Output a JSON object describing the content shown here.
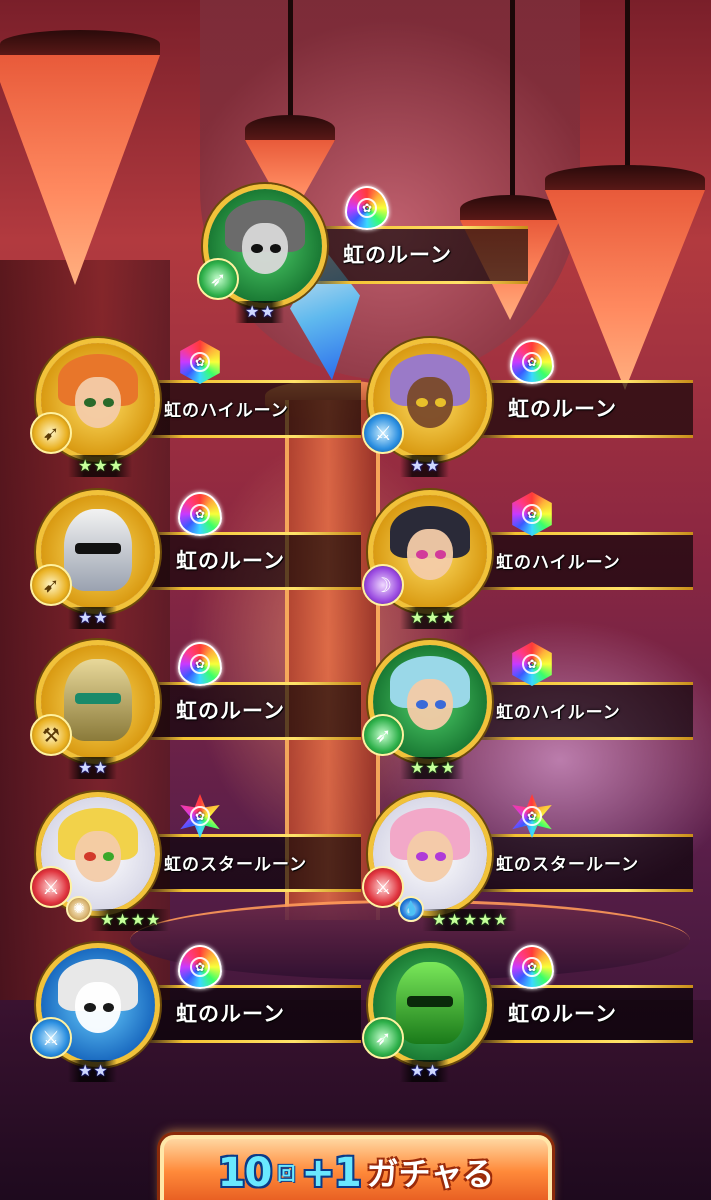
{
  "results": [
    {
      "id": "wolf-cat",
      "rune_name": "虹のルーン",
      "rune_type": "drop",
      "stars": "★★",
      "class_icon": "spear",
      "portrait_ring": "green",
      "theme": "grey"
    },
    {
      "id": "cat-girl",
      "rune_name": "虹のハイルーン",
      "rune_type": "hex",
      "stars": "★★★",
      "class_icon": "bow",
      "portrait_ring": "yellow",
      "theme": "orange"
    },
    {
      "id": "dark-elf",
      "rune_name": "虹のルーン",
      "rune_type": "drop",
      "stars": "★★",
      "class_icon": "sword",
      "portrait_ring": "yellow",
      "theme": "purple"
    },
    {
      "id": "knight-silver",
      "rune_name": "虹のルーン",
      "rune_type": "drop",
      "stars": "★★",
      "class_icon": "bow",
      "portrait_ring": "yellow",
      "theme": "silver"
    },
    {
      "id": "hood-girl",
      "rune_name": "虹のハイルーン",
      "rune_type": "hex",
      "stars": "★★★",
      "class_icon": "magic",
      "portrait_ring": "yellow",
      "theme": "green"
    },
    {
      "id": "knight-gold",
      "rune_name": "虹のルーン",
      "rune_type": "drop",
      "stars": "★★",
      "class_icon": "hammer",
      "portrait_ring": "yellow",
      "theme": "gold"
    },
    {
      "id": "blue-hair",
      "rune_name": "虹のハイルーン",
      "rune_type": "hex",
      "stars": "★★★",
      "class_icon": "spear",
      "portrait_ring": "green",
      "theme": "blue"
    },
    {
      "id": "blonde-girl",
      "rune_name": "虹のスタールーン",
      "rune_type": "star",
      "stars": "★★★★",
      "class_icon": "sword",
      "attribute_icon": "light",
      "portrait_ring": "white",
      "theme": "blonde"
    },
    {
      "id": "pink-girl",
      "rune_name": "虹のスタールーン",
      "rune_type": "star",
      "stars": "★★★★★",
      "class_icon": "sword",
      "attribute_icon": "water",
      "portrait_ring": "white",
      "theme": "pink"
    },
    {
      "id": "white-cat",
      "rune_name": "虹のルーン",
      "rune_type": "drop",
      "stars": "★★",
      "class_icon": "sword",
      "portrait_ring": "blue",
      "theme": "white"
    },
    {
      "id": "knight-green",
      "rune_name": "虹のルーン",
      "rune_type": "drop",
      "stars": "★★",
      "class_icon": "spear",
      "portrait_ring": "green",
      "theme": "green-armor"
    }
  ],
  "gacha_button": {
    "count": "10",
    "unit": "回",
    "plus": "+1",
    "label": "ガチャる"
  }
}
